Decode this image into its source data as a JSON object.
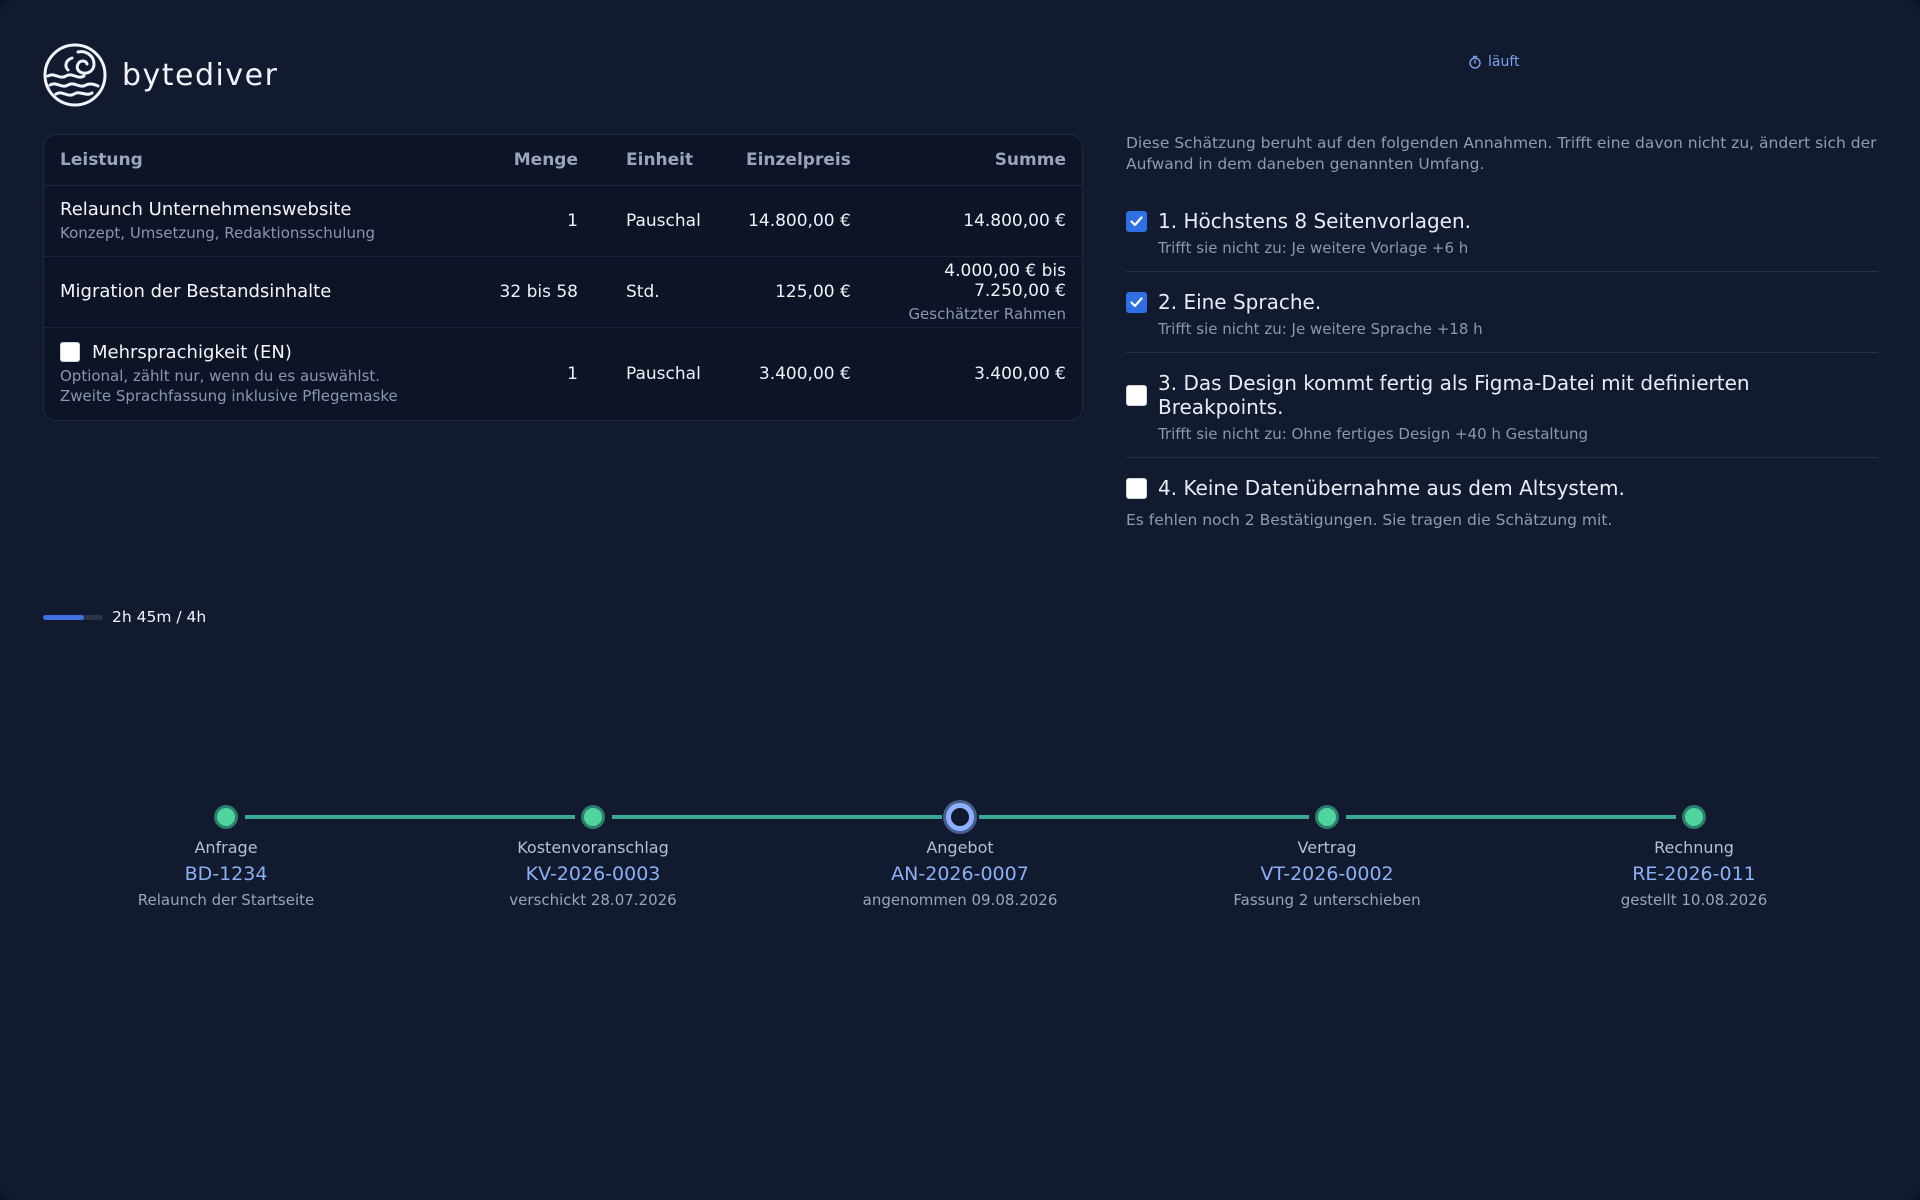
{
  "brand": {
    "name": "bytediver"
  },
  "timer": {
    "status": "läuft"
  },
  "table": {
    "headers": {
      "service": "Leistung",
      "qty": "Menge",
      "unit": "Einheit",
      "unit_price": "Einzelpreis",
      "total": "Summe"
    },
    "rows": [
      {
        "title": "Relaunch Unternehmenswebsite",
        "subtitle": "Konzept, Umsetzung, Redaktionsschulung",
        "qty": "1",
        "unit": "Pauschal",
        "unit_price": "14.800,00 €",
        "total": "14.800,00 €"
      },
      {
        "title": "Migration der Bestandsinhalte",
        "qty": "32 bis 58",
        "unit": "Std.",
        "unit_price": "125,00 €",
        "total": "4.000,00 € bis 7.250,00 €",
        "total_note": "Geschätzter Rahmen"
      },
      {
        "title": "Mehrsprachigkeit (EN)",
        "optional_note": "Optional, zählt nur, wenn du es auswählst.",
        "subtitle": "Zweite Sprachfassung inklusive Pflegemaske",
        "qty": "1",
        "unit": "Pauschal",
        "unit_price": "3.400,00 €",
        "total": "3.400,00 €",
        "checked": false
      }
    ]
  },
  "assumptions": {
    "intro": "Diese Schätzung beruht auf den folgenden Annahmen. Trifft eine davon nicht zu, ändert sich der Aufwand in dem daneben genannten Umfang.",
    "items": [
      {
        "title": "1. Höchstens 8 Seitenvorlagen.",
        "note": "Trifft sie nicht zu: Je weitere Vorlage +6 h",
        "checked": true
      },
      {
        "title": "2. Eine Sprache.",
        "note": "Trifft sie nicht zu: Je weitere Sprache +18 h",
        "checked": true
      },
      {
        "title": "3. Das Design kommt fertig als Figma-Datei mit definierten Breakpoints.",
        "note": "Trifft sie nicht zu: Ohne fertiges Design +40 h Gestaltung",
        "checked": false
      },
      {
        "title": "4. Keine Datenübernahme aus dem Altsystem.",
        "checked": false
      }
    ],
    "remaining": "Es fehlen noch 2 Bestätigungen. Sie tragen die Schätzung mit."
  },
  "progress": {
    "label": "2h 45m / 4h",
    "fraction": 0.6875,
    "color": "#3d72e0"
  },
  "timeline": {
    "stages": [
      {
        "label": "Anfrage",
        "id": "BD-1234",
        "note": "Relaunch der Startseite",
        "state": "done"
      },
      {
        "label": "Kostenvoranschlag",
        "id": "KV-2026-0003",
        "note": "verschickt 28.07.2026",
        "state": "done"
      },
      {
        "label": "Angebot",
        "id": "AN-2026-0007",
        "note": "angenommen 09.08.2026",
        "state": "current"
      },
      {
        "label": "Vertrag",
        "id": "VT-2026-0002",
        "note": "Fassung 2 unterschieben",
        "state": "done"
      },
      {
        "label": "Rechnung",
        "id": "RE-2026-011",
        "note": "gestellt 10.08.2026",
        "state": "done"
      }
    ]
  },
  "colors": {
    "accent": "#2f6fe4",
    "done": "#4fd49e",
    "line": "#3aa893",
    "link": "#8cb0f5"
  }
}
